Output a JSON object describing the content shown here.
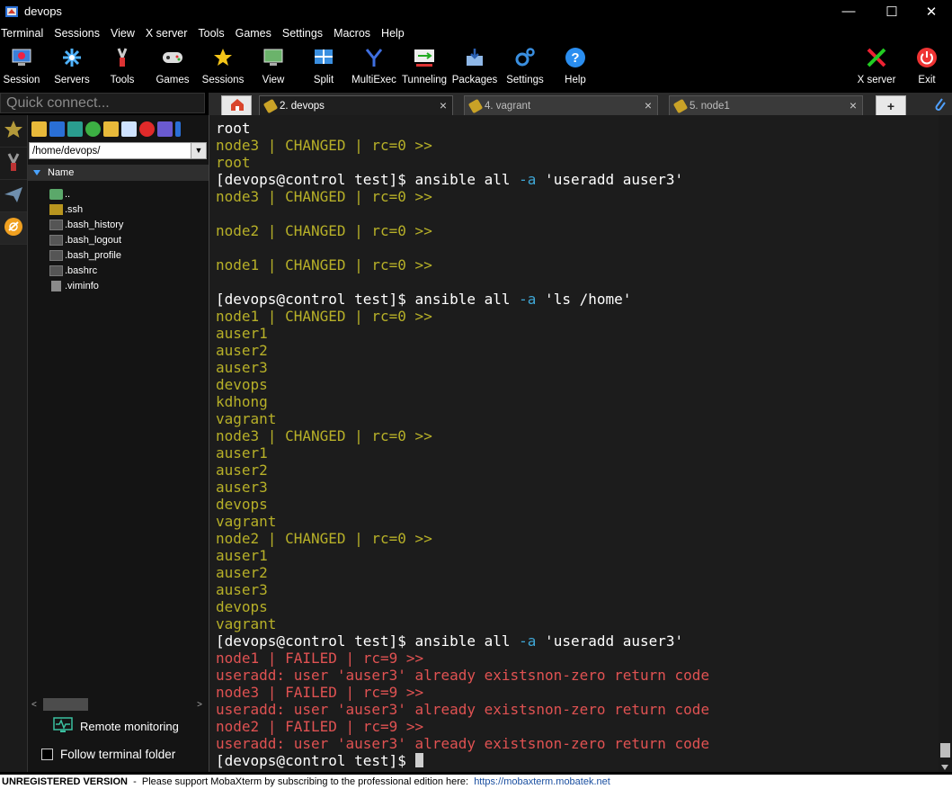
{
  "window": {
    "title": "devops",
    "controls": {
      "minimize": "—",
      "maximize": "☐",
      "close": "✕"
    }
  },
  "menu": [
    "Terminal",
    "Sessions",
    "View",
    "X server",
    "Tools",
    "Games",
    "Settings",
    "Macros",
    "Help"
  ],
  "toolbar": {
    "left": [
      {
        "label": "Session",
        "icon": "monitor-icon"
      },
      {
        "label": "Servers",
        "icon": "servers-icon"
      },
      {
        "label": "Tools",
        "icon": "tools-icon"
      },
      {
        "label": "Games",
        "icon": "gamepad-icon"
      },
      {
        "label": "Sessions",
        "icon": "star-icon"
      },
      {
        "label": "View",
        "icon": "view-icon"
      },
      {
        "label": "Split",
        "icon": "split-icon"
      },
      {
        "label": "MultiExec",
        "icon": "multiexec-icon"
      },
      {
        "label": "Tunneling",
        "icon": "tunneling-icon"
      },
      {
        "label": "Packages",
        "icon": "packages-icon"
      },
      {
        "label": "Settings",
        "icon": "gears-icon"
      },
      {
        "label": "Help",
        "icon": "help-icon"
      }
    ],
    "right": [
      {
        "label": "X server",
        "icon": "xserver-icon"
      },
      {
        "label": "Exit",
        "icon": "power-icon"
      }
    ]
  },
  "quick_connect": {
    "placeholder": "Quick connect..."
  },
  "tabs": [
    {
      "label": "2. devops",
      "active": true
    },
    {
      "label": "4. vagrant",
      "active": false
    },
    {
      "label": "5. node1",
      "active": false
    }
  ],
  "sftp": {
    "path": "/home/devops/",
    "column": "Name",
    "files": [
      "..",
      ".ssh",
      ".bash_history",
      ".bash_logout",
      ".bash_profile",
      ".bashrc",
      ".viminfo"
    ],
    "remote_monitoring": "Remote monitoring",
    "follow_folder": "Follow terminal folder"
  },
  "terminal": {
    "lines": [
      [
        {
          "t": "root",
          "c": "w"
        }
      ],
      [
        {
          "t": "node3 | CHANGED | rc=0 >>",
          "c": "y"
        }
      ],
      [
        {
          "t": "root",
          "c": "y"
        }
      ],
      [
        {
          "t": "[devops@control test]$ ansible all ",
          "c": "w"
        },
        {
          "t": "-a",
          "c": "b"
        },
        {
          "t": " 'useradd auser3'",
          "c": "w"
        }
      ],
      [
        {
          "t": "node3 | CHANGED | rc=0 >>",
          "c": "y"
        }
      ],
      [
        {
          "t": "",
          "c": "w"
        }
      ],
      [
        {
          "t": "node2 | CHANGED | rc=0 >>",
          "c": "y"
        }
      ],
      [
        {
          "t": "",
          "c": "w"
        }
      ],
      [
        {
          "t": "node1 | CHANGED | rc=0 >>",
          "c": "y"
        }
      ],
      [
        {
          "t": "",
          "c": "w"
        }
      ],
      [
        {
          "t": "[devops@control test]$ ansible all ",
          "c": "w"
        },
        {
          "t": "-a",
          "c": "b"
        },
        {
          "t": " 'ls /home'",
          "c": "w"
        }
      ],
      [
        {
          "t": "node1 | CHANGED | rc=0 >>",
          "c": "y"
        }
      ],
      [
        {
          "t": "auser1",
          "c": "y"
        }
      ],
      [
        {
          "t": "auser2",
          "c": "y"
        }
      ],
      [
        {
          "t": "auser3",
          "c": "y"
        }
      ],
      [
        {
          "t": "devops",
          "c": "y"
        }
      ],
      [
        {
          "t": "kdhong",
          "c": "y"
        }
      ],
      [
        {
          "t": "vagrant",
          "c": "y"
        }
      ],
      [
        {
          "t": "node3 | CHANGED | rc=0 >>",
          "c": "y"
        }
      ],
      [
        {
          "t": "auser1",
          "c": "y"
        }
      ],
      [
        {
          "t": "auser2",
          "c": "y"
        }
      ],
      [
        {
          "t": "auser3",
          "c": "y"
        }
      ],
      [
        {
          "t": "devops",
          "c": "y"
        }
      ],
      [
        {
          "t": "vagrant",
          "c": "y"
        }
      ],
      [
        {
          "t": "node2 | CHANGED | rc=0 >>",
          "c": "y"
        }
      ],
      [
        {
          "t": "auser1",
          "c": "y"
        }
      ],
      [
        {
          "t": "auser2",
          "c": "y"
        }
      ],
      [
        {
          "t": "auser3",
          "c": "y"
        }
      ],
      [
        {
          "t": "devops",
          "c": "y"
        }
      ],
      [
        {
          "t": "vagrant",
          "c": "y"
        }
      ],
      [
        {
          "t": "[devops@control test]$ ansible all ",
          "c": "w"
        },
        {
          "t": "-a",
          "c": "b"
        },
        {
          "t": " 'useradd auser3'",
          "c": "w"
        }
      ],
      [
        {
          "t": "node1 | FAILED | rc=9 >>",
          "c": "r"
        }
      ],
      [
        {
          "t": "useradd: user 'auser3' already existsnon-zero return code",
          "c": "r"
        }
      ],
      [
        {
          "t": "node3 | FAILED | rc=9 >>",
          "c": "r"
        }
      ],
      [
        {
          "t": "useradd: user 'auser3' already existsnon-zero return code",
          "c": "r"
        }
      ],
      [
        {
          "t": "node2 | FAILED | rc=9 >>",
          "c": "r"
        }
      ],
      [
        {
          "t": "useradd: user 'auser3' already existsnon-zero return code",
          "c": "r"
        }
      ]
    ],
    "prompt": "[devops@control test]$ "
  },
  "status": {
    "unregistered": "UNREGISTERED VERSION",
    "message": "  -  Please support MobaXterm by subscribing to the professional edition here:  ",
    "link": "https://mobaxterm.mobatek.net"
  }
}
